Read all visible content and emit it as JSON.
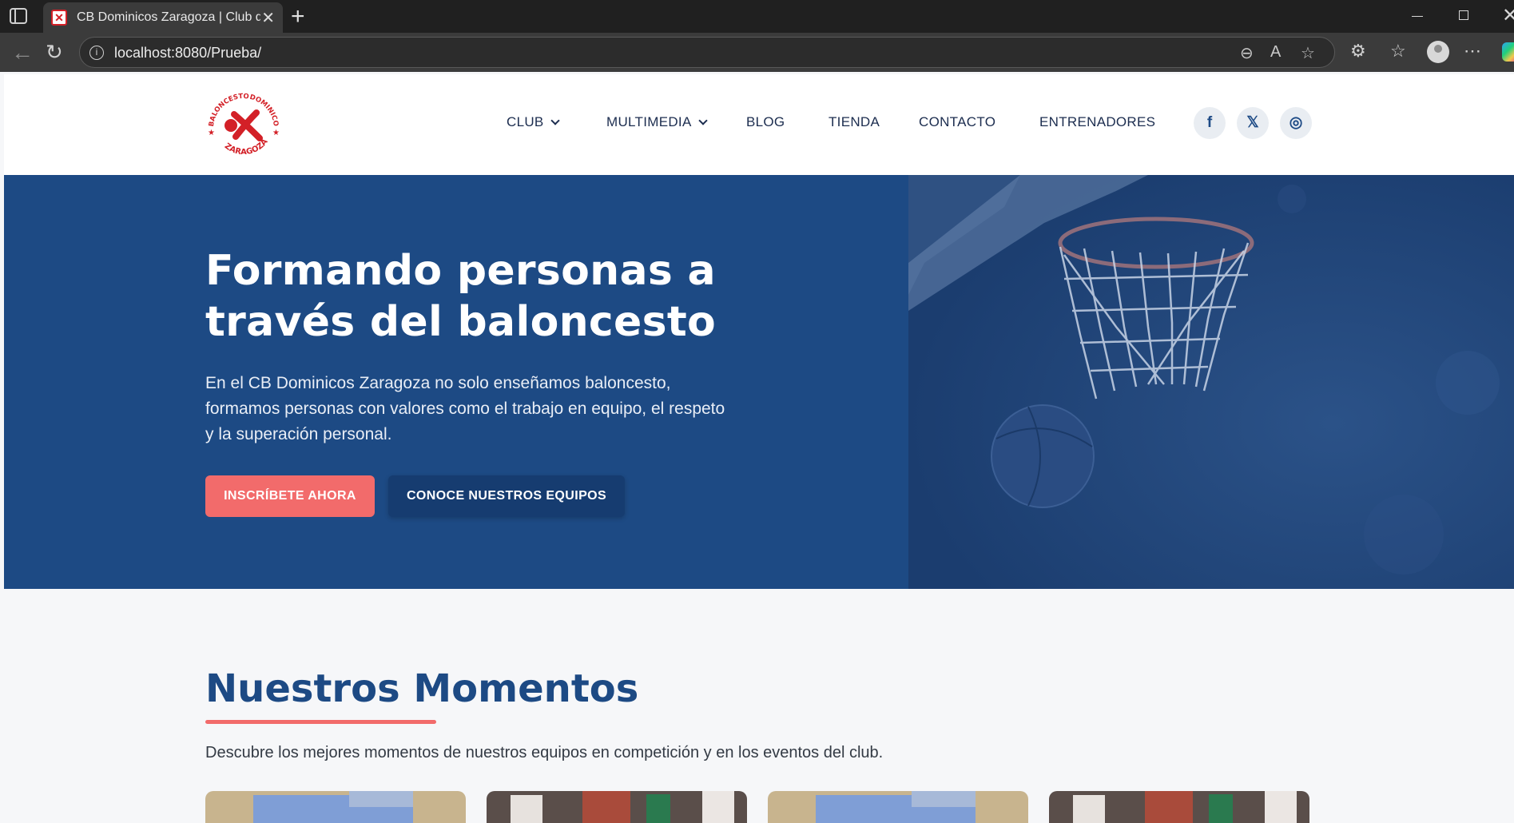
{
  "browser": {
    "tab_title": "CB Dominicos Zaragoza | Club de",
    "url": "localhost:8080/Prueba/"
  },
  "header": {
    "logo_text": [
      "BALONCESTO",
      "DOMINICOS",
      "ZARAGOZA"
    ],
    "nav": [
      {
        "label": "CLUB",
        "has_dropdown": true
      },
      {
        "label": "MULTIMEDIA",
        "has_dropdown": true
      },
      {
        "label": "BLOG",
        "has_dropdown": false
      },
      {
        "label": "TIENDA",
        "has_dropdown": false
      },
      {
        "label": "CONTACTO",
        "has_dropdown": false
      },
      {
        "label": "ENTRENADORES",
        "has_dropdown": false
      }
    ],
    "social": [
      {
        "name": "facebook-icon",
        "glyph": "f"
      },
      {
        "name": "x-twitter-icon",
        "glyph": "𝕏"
      },
      {
        "name": "instagram-icon",
        "glyph": "◎"
      }
    ]
  },
  "hero": {
    "title": "Formando personas a través del baloncesto",
    "subtitle": "En el CB Dominicos Zaragoza no solo enseñamos baloncesto, formamos personas con valores como el trabajo en equipo, el respeto y la superación personal.",
    "primary_cta": "INSCRÍBETE AHORA",
    "secondary_cta": "CONOCE NUESTROS EQUIPOS"
  },
  "moments": {
    "title": "Nuestros Momentos",
    "description": "Descubre los mejores momentos de nuestros equipos en competición y en los eventos del club."
  },
  "colors": {
    "brand_blue": "#1d4a84",
    "accent_coral": "#f26b6b",
    "logo_red": "#d32027"
  }
}
